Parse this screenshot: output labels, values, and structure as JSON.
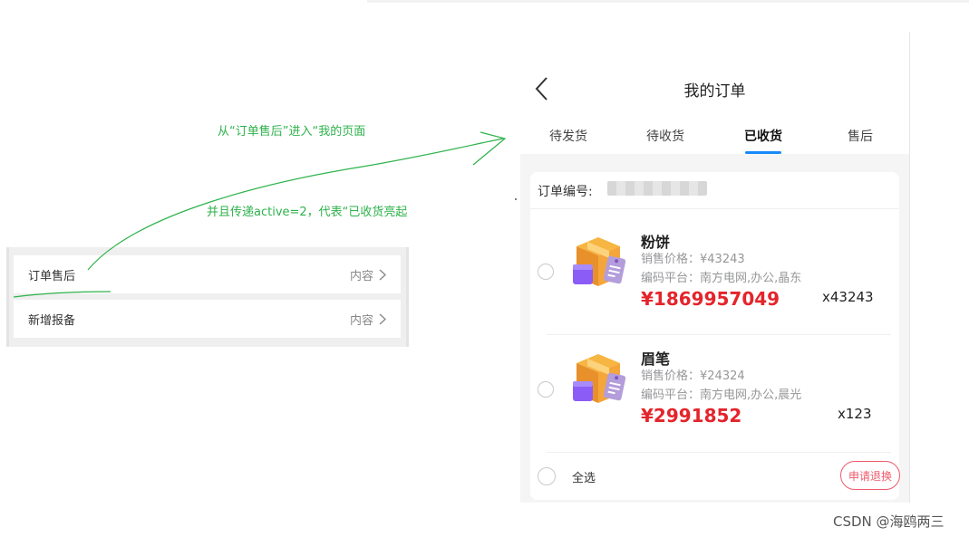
{
  "left_list": {
    "items": [
      {
        "label": "订单售后",
        "value": "内容"
      },
      {
        "label": "新增报备",
        "value": "内容"
      }
    ]
  },
  "annotations": {
    "line1": "从“订单售后”进入“我的页面",
    "line2": "并且传递active=2，代表“已收货亮起"
  },
  "page": {
    "title": "我的订单",
    "tabs": [
      "待发货",
      "待收货",
      "已收货",
      "售后"
    ],
    "active_tab_index": 2
  },
  "order": {
    "number_label": "订单编号:",
    "products": [
      {
        "name": "粉饼",
        "sale_price": "销售价格：¥43243",
        "platform": "编码平台：南方电网,办公,晶东",
        "price": "¥1869957049",
        "quantity": "x43243"
      },
      {
        "name": "眉笔",
        "sale_price": "销售价格：¥24324",
        "platform": "编码平台：南方电网,办公,晨光",
        "price": "¥2991852",
        "quantity": "x123"
      }
    ],
    "select_all_label": "全选",
    "refund_button": "申请退换"
  },
  "watermark": "CSDN @海鸥两三",
  "colors": {
    "accent_green": "#2db24b",
    "price_red": "#e4242b",
    "tab_underline_blue": "#1989fa",
    "refund_pink": "#ee5a6b"
  },
  "icons": [
    "back-arrow-icon",
    "chevron-right-icon",
    "package-icon"
  ]
}
